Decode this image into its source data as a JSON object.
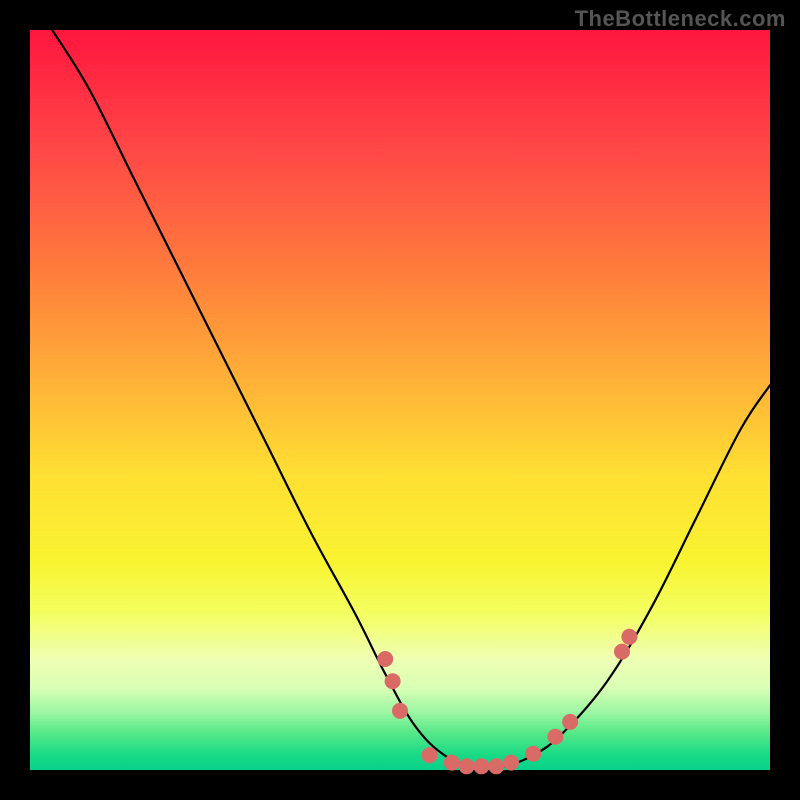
{
  "watermark": "TheBottleneck.com",
  "colors": {
    "dot_fill": "#d96a66",
    "curve_stroke": "#000000"
  },
  "chart_data": {
    "type": "line",
    "title": "",
    "xlabel": "",
    "ylabel": "",
    "xlim": [
      0,
      100
    ],
    "ylim": [
      0,
      100
    ],
    "grid": false,
    "legend": false,
    "curve": [
      {
        "x": 3,
        "y": 100
      },
      {
        "x": 8,
        "y": 92
      },
      {
        "x": 14,
        "y": 80
      },
      {
        "x": 20,
        "y": 68
      },
      {
        "x": 26,
        "y": 56
      },
      {
        "x": 32,
        "y": 44
      },
      {
        "x": 38,
        "y": 32
      },
      {
        "x": 44,
        "y": 21
      },
      {
        "x": 48,
        "y": 13
      },
      {
        "x": 52,
        "y": 6
      },
      {
        "x": 56,
        "y": 2
      },
      {
        "x": 60,
        "y": 0.5
      },
      {
        "x": 64,
        "y": 0.5
      },
      {
        "x": 68,
        "y": 2
      },
      {
        "x": 72,
        "y": 5
      },
      {
        "x": 78,
        "y": 12
      },
      {
        "x": 84,
        "y": 22
      },
      {
        "x": 90,
        "y": 34
      },
      {
        "x": 96,
        "y": 46
      },
      {
        "x": 100,
        "y": 52
      }
    ],
    "points": [
      {
        "x": 48,
        "y": 15
      },
      {
        "x": 49,
        "y": 12
      },
      {
        "x": 50,
        "y": 8
      },
      {
        "x": 54,
        "y": 2
      },
      {
        "x": 57,
        "y": 1
      },
      {
        "x": 59,
        "y": 0.5
      },
      {
        "x": 61,
        "y": 0.5
      },
      {
        "x": 63,
        "y": 0.5
      },
      {
        "x": 65,
        "y": 1
      },
      {
        "x": 68,
        "y": 2.2
      },
      {
        "x": 71,
        "y": 4.5
      },
      {
        "x": 73,
        "y": 6.5
      },
      {
        "x": 80,
        "y": 16
      },
      {
        "x": 81,
        "y": 18
      }
    ]
  }
}
